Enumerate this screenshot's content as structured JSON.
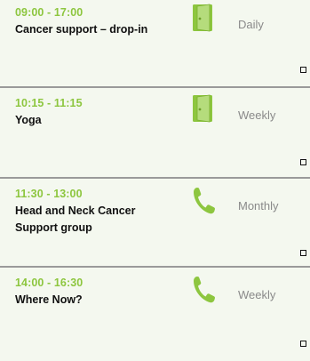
{
  "events": [
    {
      "time": "09:00 - 17:00",
      "title": "Cancer support – drop-in",
      "icon": "door-icon",
      "frequency": "Daily"
    },
    {
      "time": "10:15 - 11:15",
      "title": "Yoga",
      "icon": "door-icon",
      "frequency": "Weekly"
    },
    {
      "time": "11:30 - 13:00",
      "title": "Head and Neck Cancer Support group",
      "icon": "phone-icon",
      "frequency": "Monthly"
    },
    {
      "time": "14:00 - 16:30",
      "title": "Where Now?",
      "icon": "phone-icon",
      "frequency": "Weekly"
    }
  ],
  "colors": {
    "accent": "#8dc63f",
    "background": "#f4f8ef",
    "text": "#111111",
    "muted": "#8a8a8a",
    "divider": "#9a9a9a"
  }
}
